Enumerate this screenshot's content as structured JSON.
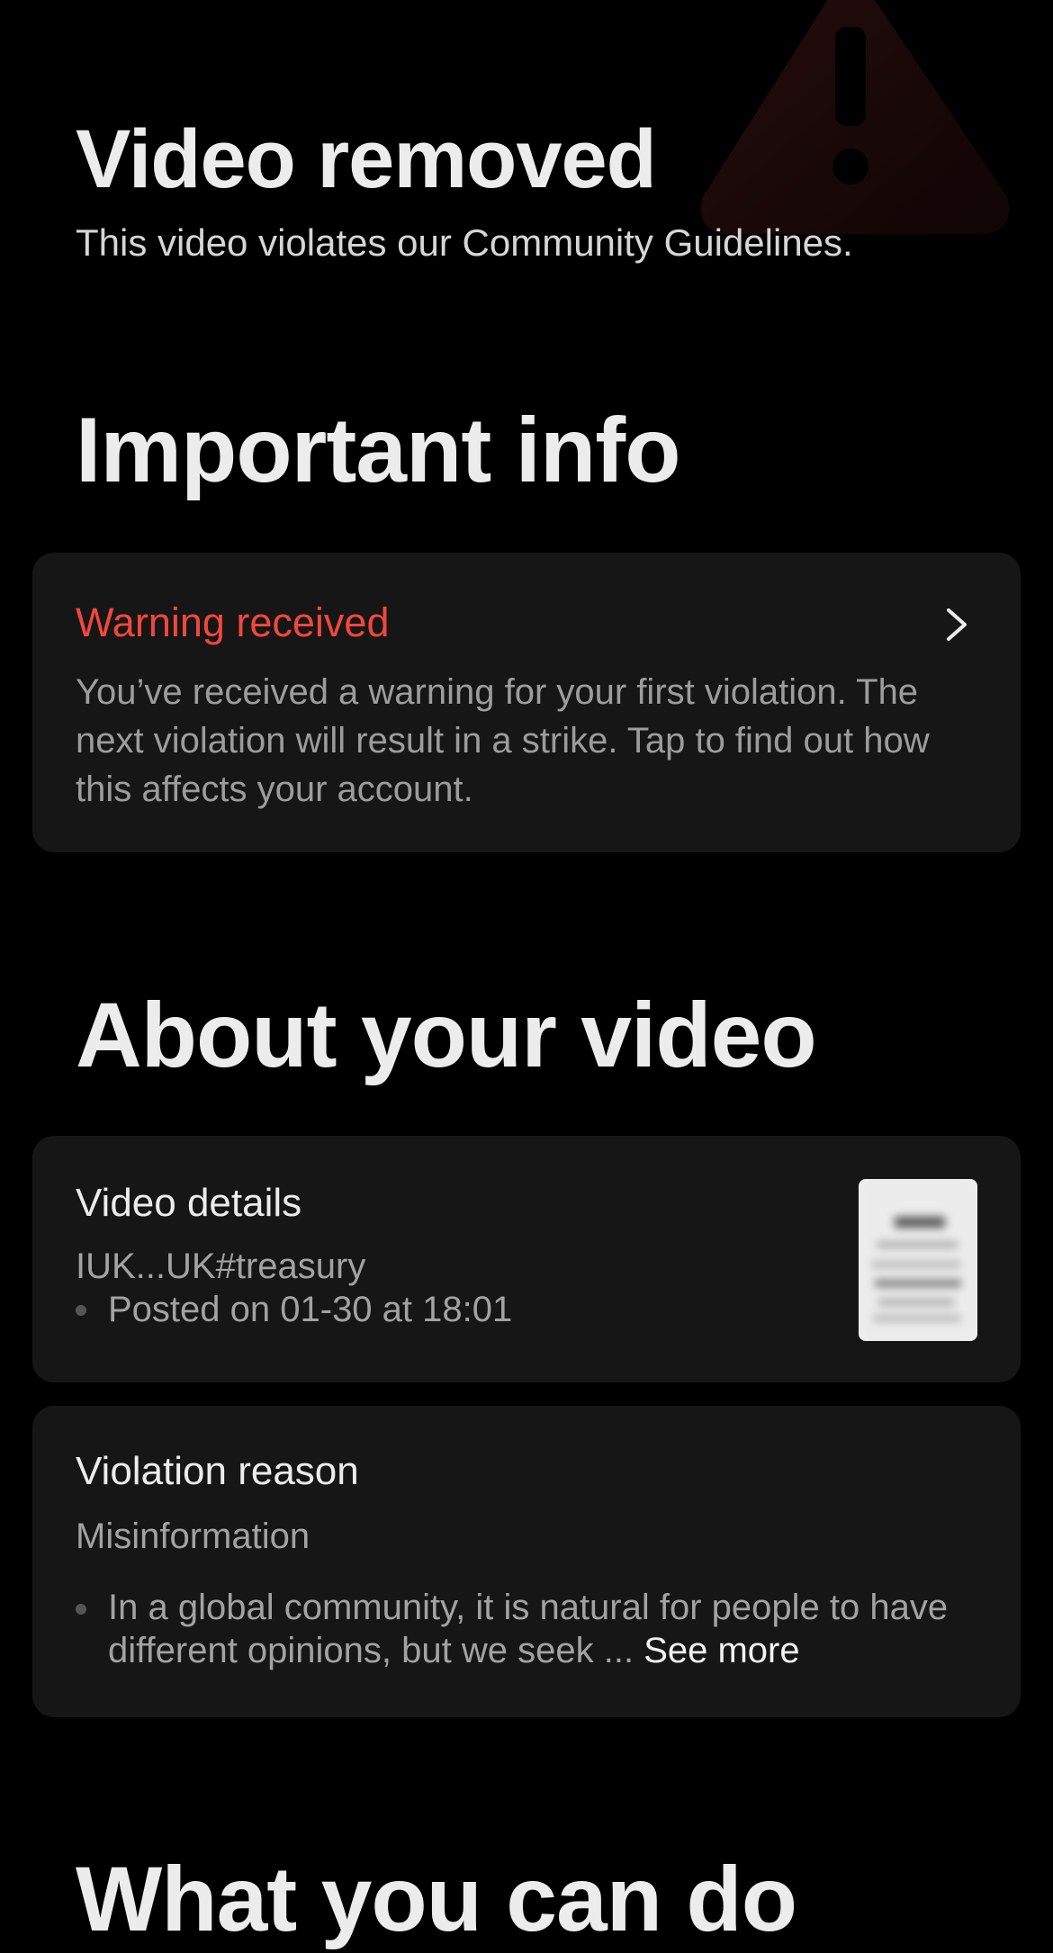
{
  "header": {
    "back_icon": "back-chevron-icon",
    "background_icon": "warning-triangle-icon"
  },
  "removal": {
    "title": "Video removed",
    "subtitle": "This video violates our Community Guidelines."
  },
  "important_info": {
    "heading": "Important info",
    "warning": {
      "title": "Warning received",
      "text": "You’ve received a warning for your first violation. The next violation will result in a strike. Tap to find out how this affects your account.",
      "chevron_icon": "chevron-right-icon"
    }
  },
  "about_video": {
    "heading": "About your video",
    "video_details": {
      "title": "Video details",
      "caption": "IUK...UK#treasury",
      "posted": "Posted on 01-30 at 18:01",
      "thumbnail_icon": "video-thumbnail"
    },
    "violation": {
      "title": "Violation reason",
      "category": "Misinformation",
      "text": "In a global community, it is natural for people to have different opinions, but we seek ...",
      "see_more": "See more"
    }
  },
  "next_section": {
    "heading": "What you can do"
  },
  "colors": {
    "background": "#000000",
    "card": "#161616",
    "accent_red": "#f0473d",
    "primary_text": "#ececec",
    "secondary_text": "#a2a2a2"
  }
}
